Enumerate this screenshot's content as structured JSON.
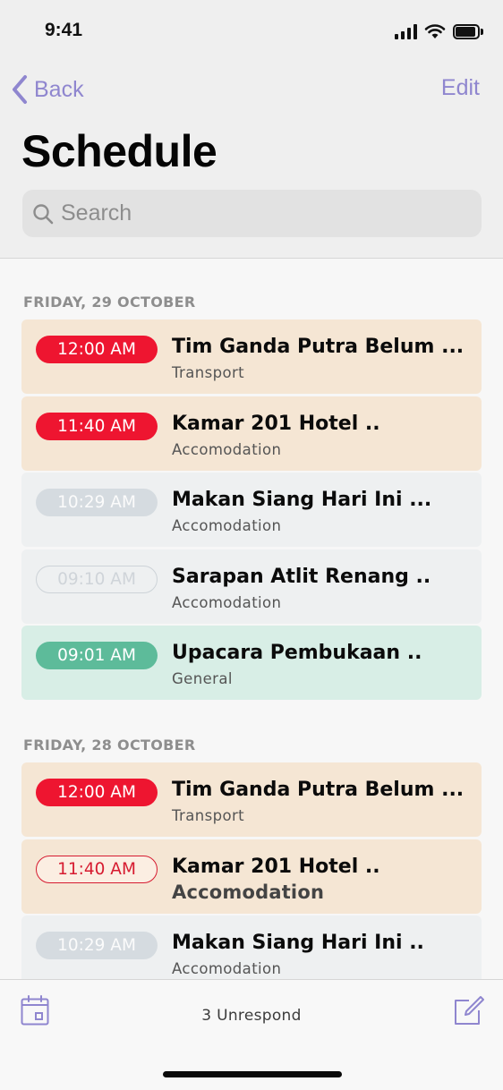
{
  "status_bar": {
    "time": "9:41"
  },
  "nav": {
    "back_label": "Back",
    "edit_label": "Edit",
    "title": "Schedule"
  },
  "search": {
    "placeholder": "Search"
  },
  "sections": [
    {
      "header": "FRIDAY, 29 OCTOBER",
      "items": [
        {
          "time": "12:00 AM",
          "title": "Tim Ganda Putra Belum ...",
          "category": "Transport"
        },
        {
          "time": "11:40 AM",
          "title": "Kamar 201 Hotel ..",
          "category": "Accomodation"
        },
        {
          "time": "10:29 AM",
          "title": "Makan Siang Hari Ini ...",
          "category": "Accomodation"
        },
        {
          "time": "09:10 AM",
          "title": "Sarapan Atlit Renang ..",
          "category": "Accomodation"
        },
        {
          "time": "09:01 AM",
          "title": "Upacara Pembukaan ..",
          "category": "General"
        }
      ]
    },
    {
      "header": "FRIDAY, 28 OCTOBER",
      "items": [
        {
          "time": "12:00 AM",
          "title": "Tim Ganda Putra Belum ...",
          "category": "Transport"
        },
        {
          "time": "11:40 AM",
          "title": "Kamar 201 Hotel ..",
          "category": "Accomodation"
        },
        {
          "time": "10:29 AM",
          "title": "Makan Siang Hari Ini ..",
          "category": "Accomodation"
        }
      ]
    }
  ],
  "toolbar": {
    "status": "3 Unrespond"
  },
  "colors": {
    "accent": "#8f86cf",
    "urgent": "#ee1530",
    "done": "#5dbb9a",
    "card_orange": "#f5e6d4",
    "card_gray": "#eef0f1",
    "card_green": "#d8eee6"
  },
  "icons": [
    "chevron-left-icon",
    "search-icon",
    "calendar-icon",
    "compose-icon",
    "signal-icon",
    "wifi-icon",
    "battery-icon"
  ]
}
